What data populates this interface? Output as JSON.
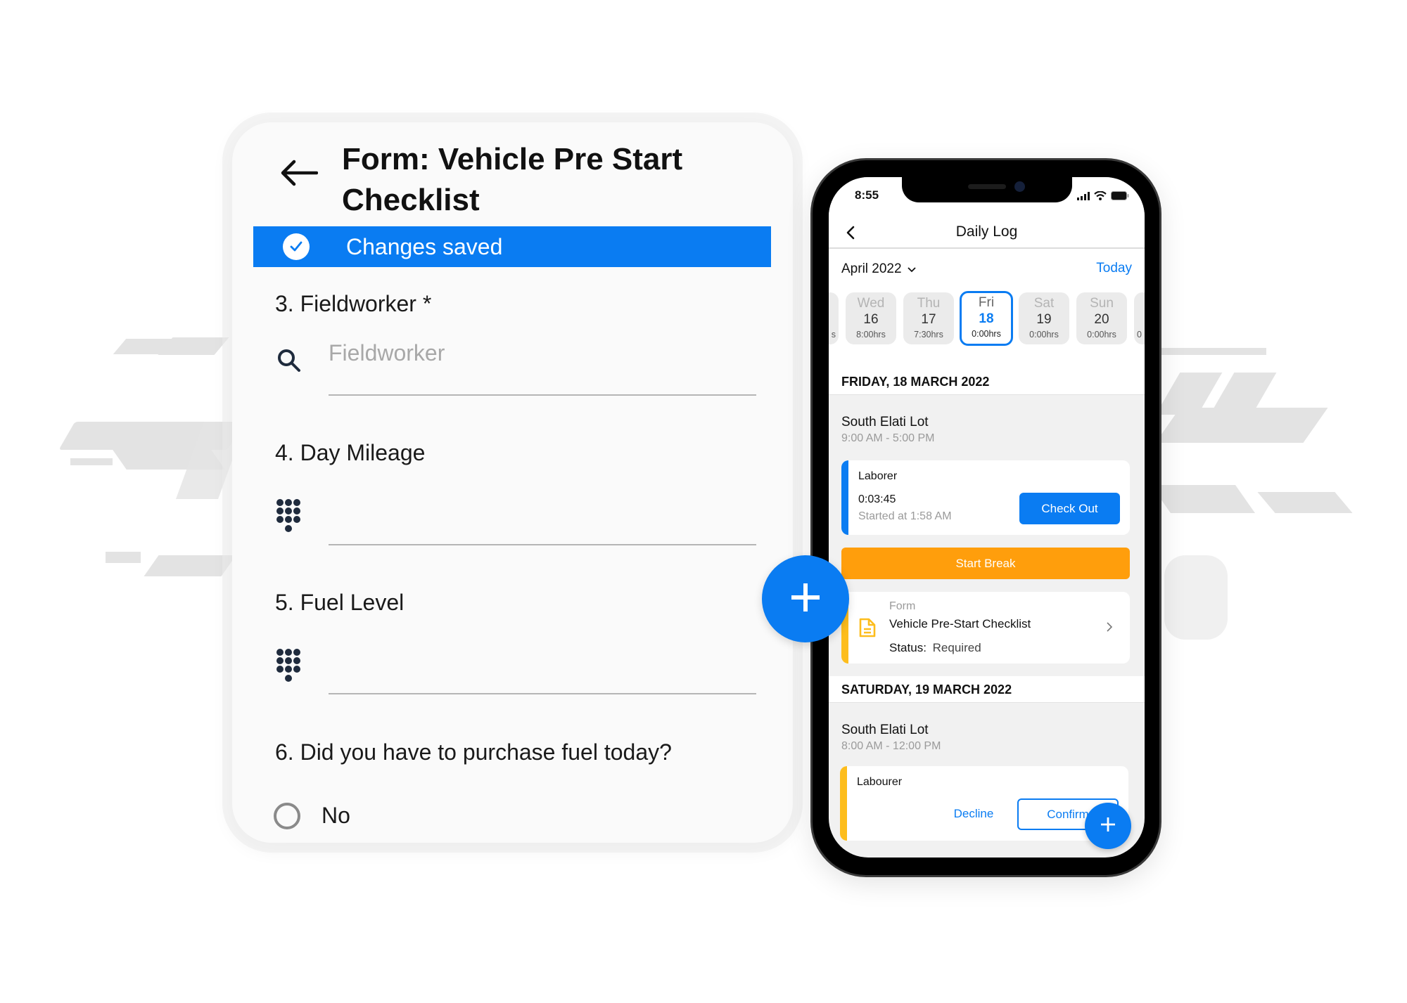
{
  "form": {
    "title": "Form: Vehicle Pre Start Checklist",
    "banner": {
      "text": "Changes saved",
      "color": "#0a7cf2"
    },
    "questions": [
      {
        "label": "3. Fieldworker *",
        "type": "search",
        "placeholder": "Fieldworker",
        "value": ""
      },
      {
        "label": "4. Day Mileage",
        "type": "number",
        "value": ""
      },
      {
        "label": "5. Fuel Level",
        "type": "number",
        "value": ""
      },
      {
        "label": "6. Did you have to purchase fuel today?",
        "type": "radio",
        "options": [
          "No"
        ],
        "selected": null
      }
    ]
  },
  "center_fab": {
    "icon": "plus-icon"
  },
  "phone": {
    "status_bar": {
      "time": "8:55"
    },
    "nav": {
      "title": "Daily Log"
    },
    "month": {
      "label": "April 2022",
      "today_label": "Today"
    },
    "days": [
      {
        "name": "",
        "num": "",
        "hours": "s",
        "partial": "left"
      },
      {
        "name": "Wed",
        "num": "16",
        "hours": "8:00hrs"
      },
      {
        "name": "Thu",
        "num": "17",
        "hours": "7:30hrs"
      },
      {
        "name": "Fri",
        "num": "18",
        "hours": "0:00hrs",
        "selected": true
      },
      {
        "name": "Sat",
        "num": "19",
        "hours": "0:00hrs"
      },
      {
        "name": "Sun",
        "num": "20",
        "hours": "0:00hrs"
      },
      {
        "name": "",
        "num": "",
        "hours": "0",
        "partial": "right"
      }
    ],
    "sections": [
      {
        "header": "FRIDAY, 18 MARCH 2022",
        "location": "South Elati Lot",
        "time": "9:00 AM - 5:00 PM",
        "shift": {
          "role": "Laborer",
          "timer": "0:03:45",
          "started": "Started at 1:58 AM",
          "action": "Check Out",
          "accent": "#0a7cf2"
        },
        "break_button": "Start Break",
        "form_item": {
          "kind": "Form",
          "name": "Vehicle Pre-Start Checklist",
          "status_label": "Status:",
          "status_value": "Required",
          "accent": "#fdbd1d"
        }
      },
      {
        "header": "SATURDAY, 19 MARCH 2022",
        "location": "South Elati Lot",
        "time": "8:00 AM - 12:00 PM",
        "shift": {
          "role": "Labourer",
          "decline": "Decline",
          "confirm": "Confirm",
          "accent": "#fdbd1d"
        }
      }
    ],
    "fab": {
      "icon": "plus-icon"
    }
  },
  "colors": {
    "accent": "#0a7cf2",
    "warning": "#ff9e0c",
    "pending": "#fdbd1d"
  }
}
